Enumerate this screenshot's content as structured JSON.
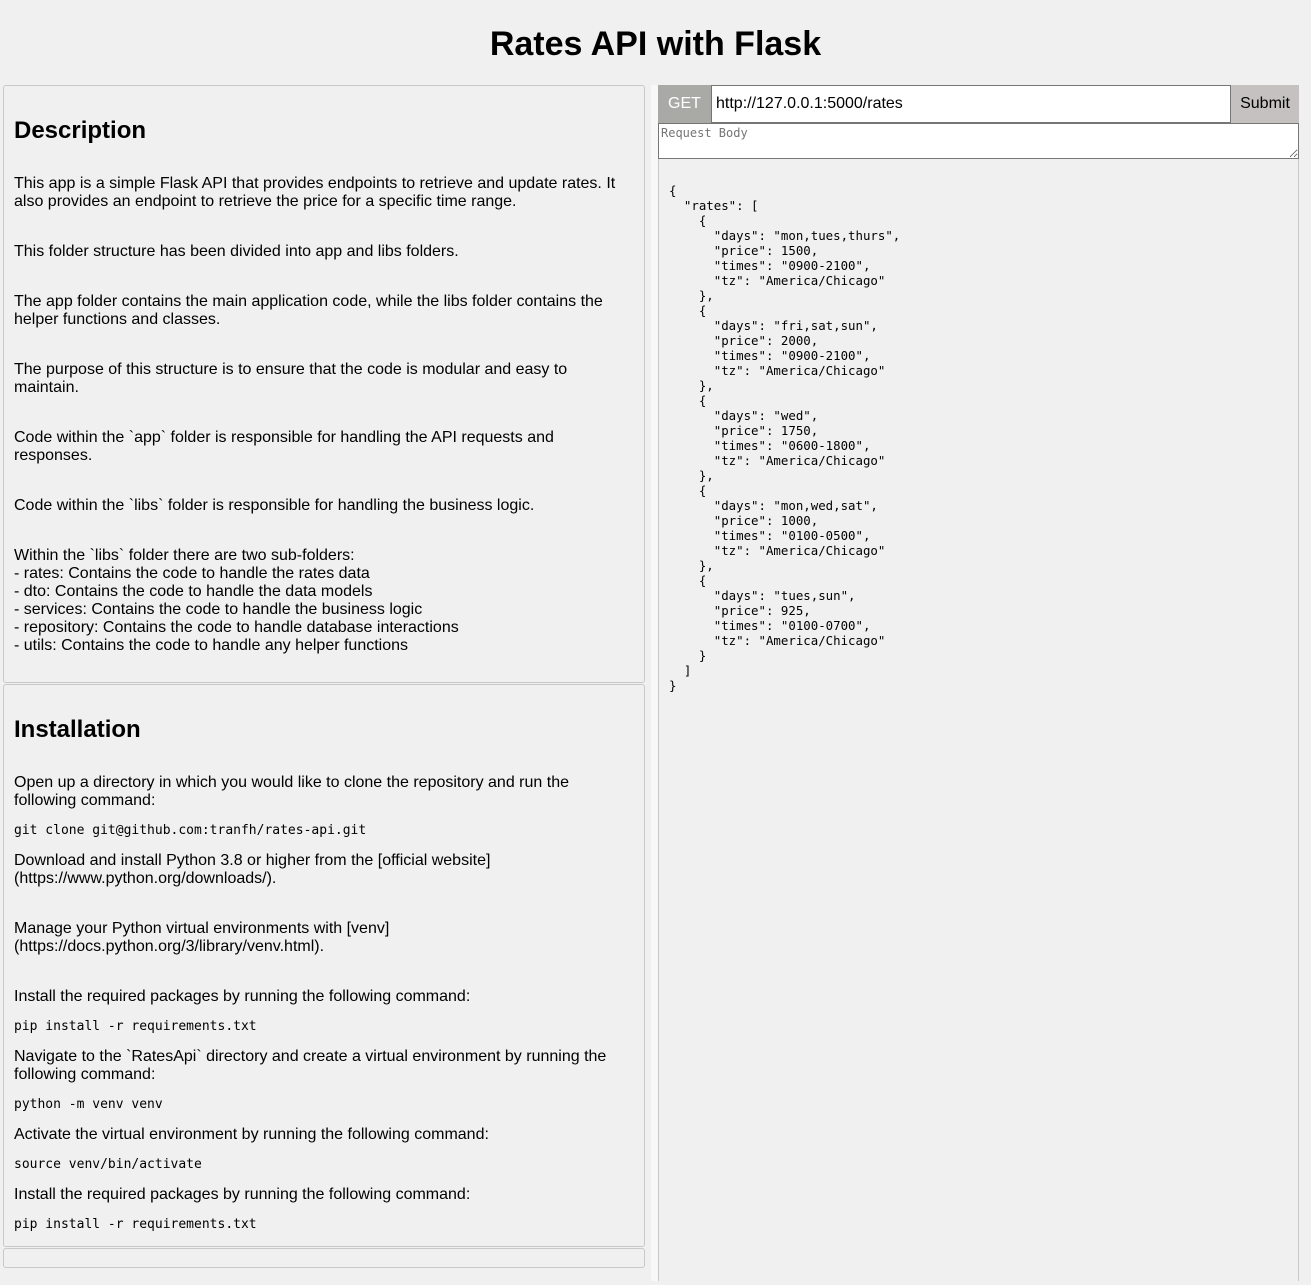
{
  "header": {
    "title": "Rates API with Flask"
  },
  "description": {
    "heading": "Description",
    "paragraphs": [
      "This app is a simple Flask API that provides endpoints to retrieve and update rates. It also provides an endpoint to retrieve the price for a specific time range.",
      "This folder structure has been divided into app and libs folders.",
      "The app folder contains the main application code, while the libs folder contains the helper functions and classes.",
      "The purpose of this structure is to ensure that the code is modular and easy to maintain.",
      "Code within the `app` folder is responsible for handling the API requests and responses.",
      "Code within the `libs` folder is responsible for handling the business logic.",
      "Within the `libs` folder there are two sub-folders:\n- rates: Contains the code to handle the rates data\n- dto: Contains the code to handle the data models\n- services: Contains the code to handle the business logic\n- repository: Contains the code to handle database interactions\n- utils: Contains the code to handle any helper functions"
    ]
  },
  "installation": {
    "heading": "Installation",
    "p1": "Open up a directory in which you would like to clone the repository and run the following command:",
    "cmd1": "git clone git@github.com:tranfh/rates-api.git",
    "p2": "Download and install Python 3.8 or higher from the [official website](https://www.python.org/downloads/).",
    "p3": "Manage your Python virtual environments with [venv](https://docs.python.org/3/library/venv.html).",
    "p4": "Install the required packages by running the following command:",
    "cmd2": "pip install -r requirements.txt",
    "p5": "Navigate to the `RatesApi` directory and create a virtual environment by running the following command:",
    "cmd3": "python -m venv venv",
    "p6": "Activate the virtual environment by running the following command:",
    "cmd4": "source venv/bin/activate",
    "p7": "Install the required packages by running the following command:",
    "cmd5": "pip install -r requirements.txt"
  },
  "request": {
    "method": "GET",
    "url": "http://127.0.0.1:5000/rates",
    "submit_label": "Submit",
    "body_placeholder": "Request Body"
  },
  "response": {
    "body": "{\n  \"rates\": [\n    {\n      \"days\": \"mon,tues,thurs\",\n      \"price\": 1500,\n      \"times\": \"0900-2100\",\n      \"tz\": \"America/Chicago\"\n    },\n    {\n      \"days\": \"fri,sat,sun\",\n      \"price\": 2000,\n      \"times\": \"0900-2100\",\n      \"tz\": \"America/Chicago\"\n    },\n    {\n      \"days\": \"wed\",\n      \"price\": 1750,\n      \"times\": \"0600-1800\",\n      \"tz\": \"America/Chicago\"\n    },\n    {\n      \"days\": \"mon,wed,sat\",\n      \"price\": 1000,\n      \"times\": \"0100-0500\",\n      \"tz\": \"America/Chicago\"\n    },\n    {\n      \"days\": \"tues,sun\",\n      \"price\": 925,\n      \"times\": \"0100-0700\",\n      \"tz\": \"America/Chicago\"\n    }\n  ]\n}"
  }
}
